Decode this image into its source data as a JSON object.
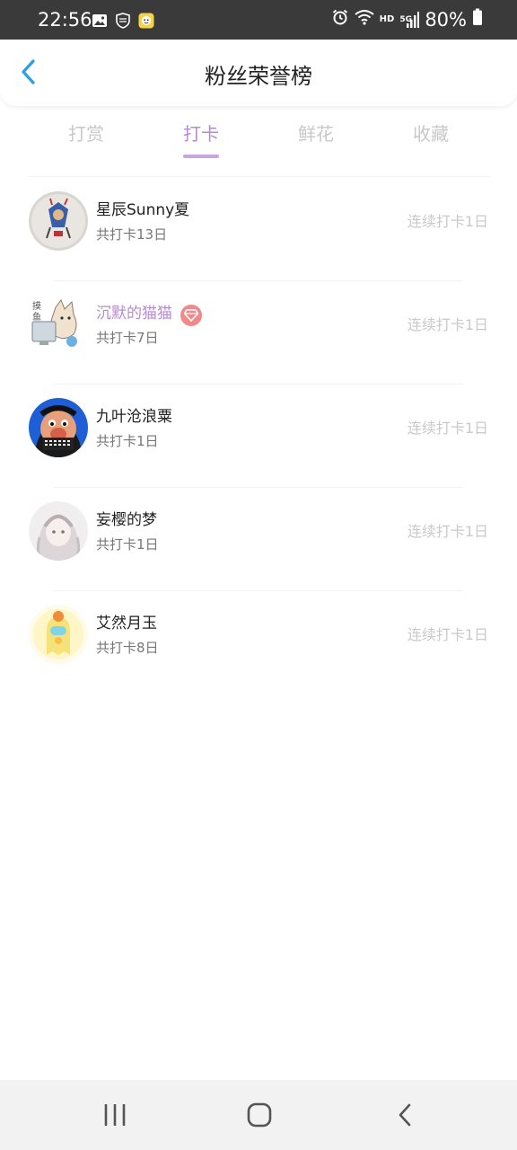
{
  "status_bar": {
    "time": "22:56",
    "left_icons": [
      "gallery-icon",
      "shield-icon",
      "app-notification-icon"
    ],
    "right_icons": [
      "alarm-icon",
      "wifi-icon",
      "hd-icon",
      "5g-signal-icon",
      "battery-icon"
    ],
    "hd_label": "HD",
    "network_label": "5G",
    "battery": "80%"
  },
  "header": {
    "title": "粉丝荣誉榜",
    "back_icon": "chevron-left-icon",
    "accent_color": "#2a9fe0"
  },
  "tabs": {
    "items": [
      {
        "label": "打赏",
        "active": false
      },
      {
        "label": "打卡",
        "active": true
      },
      {
        "label": "鲜花",
        "active": false
      },
      {
        "label": "收藏",
        "active": false
      }
    ],
    "active_color": "#b58bd0",
    "inactive_color": "#c8c8c8"
  },
  "list": {
    "items": [
      {
        "name": "星辰Sunny夏",
        "total": "共打卡13日",
        "streak": "连续打卡1日",
        "vip": false,
        "avatar": "avatar-icon"
      },
      {
        "name": "沉默的猫猫",
        "total": "共打卡7日",
        "streak": "连续打卡1日",
        "vip": true,
        "badge_icon": "diamond-icon",
        "avatar": "avatar-icon"
      },
      {
        "name": "九叶沧浪粟",
        "total": "共打卡1日",
        "streak": "连续打卡1日",
        "vip": false,
        "avatar": "avatar-icon"
      },
      {
        "name": "妄樱的梦",
        "total": "共打卡1日",
        "streak": "连续打卡1日",
        "vip": false,
        "avatar": "avatar-icon"
      },
      {
        "name": "艾然月玉",
        "total": "共打卡8日",
        "streak": "连续打卡1日",
        "vip": false,
        "avatar": "avatar-icon"
      }
    ],
    "vip_name_color": "#b58bd0",
    "vip_badge_color": "#f08a8a"
  },
  "nav_bar": {
    "buttons": [
      "recent-apps-icon",
      "home-icon",
      "back-icon"
    ]
  }
}
